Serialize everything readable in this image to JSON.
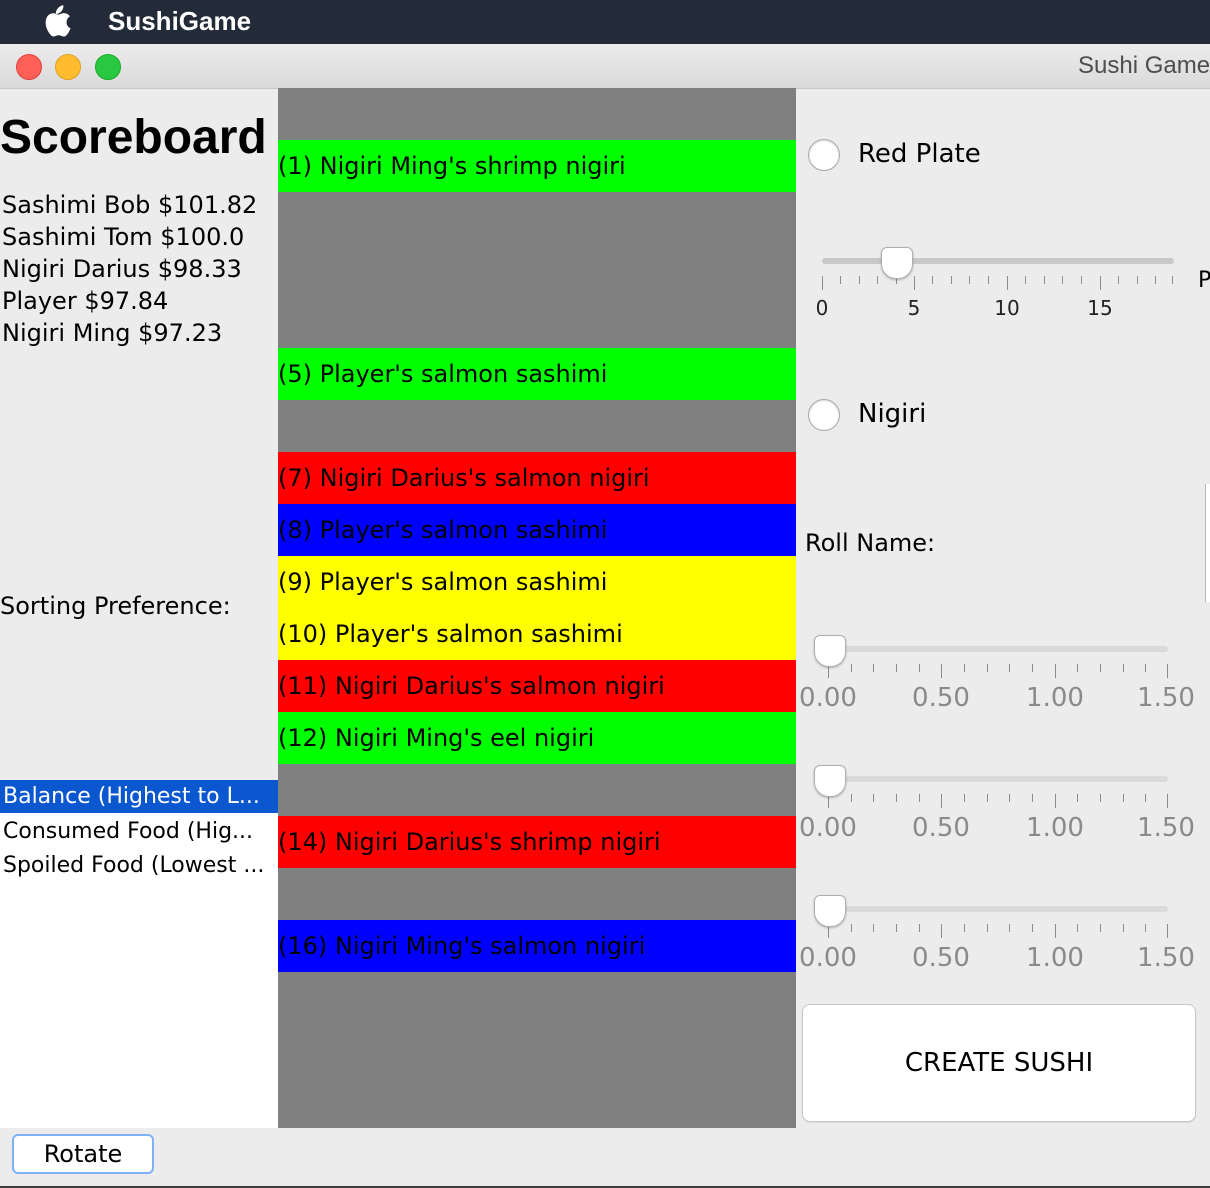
{
  "menubar": {
    "app_name": "SushiGame",
    "apple_icon": "apple-logo-icon"
  },
  "window": {
    "title": "Sushi Game"
  },
  "scoreboard": {
    "title": "Scoreboard",
    "entries": [
      "Sashimi Bob $101.82",
      "Sashimi Tom $100.0",
      "Nigiri Darius $98.33",
      "Player $97.84",
      "Nigiri Ming $97.23"
    ]
  },
  "sorting": {
    "label": "Sorting Preference:",
    "options": [
      {
        "label": "Balance (Highest to L...",
        "selected": true
      },
      {
        "label": "Consumed Food (Hig...",
        "selected": false
      },
      {
        "label": "Spoiled Food (Lowest ...",
        "selected": false
      }
    ],
    "selected_color": "#0b57d0"
  },
  "belt": {
    "background": "#808080",
    "plates": [
      {
        "slot": 1,
        "label": "(1)  Nigiri Ming's shrimp nigiri",
        "color": "#00ff00"
      },
      {
        "slot": 5,
        "label": "(5)  Player's salmon sashimi",
        "color": "#00ff00"
      },
      {
        "slot": 7,
        "label": "(7)  Nigiri Darius's salmon nigiri",
        "color": "#ff0000"
      },
      {
        "slot": 8,
        "label": "(8)  Player's salmon sashimi",
        "color": "#0000ff"
      },
      {
        "slot": 9,
        "label": "(9)  Player's salmon sashimi",
        "color": "#ffff00"
      },
      {
        "slot": 10,
        "label": "(10)  Player's salmon sashimi",
        "color": "#ffff00"
      },
      {
        "slot": 11,
        "label": "(11)  Nigiri Darius's salmon nigiri",
        "color": "#ff0000"
      },
      {
        "slot": 12,
        "label": "(12)  Nigiri Ming's eel nigiri",
        "color": "#00ff00"
      },
      {
        "slot": 14,
        "label": "(14)  Nigiri Darius's shrimp nigiri",
        "color": "#ff0000"
      },
      {
        "slot": 16,
        "label": "(16)  Nigiri Ming's salmon nigiri",
        "color": "#0000ff"
      }
    ]
  },
  "controls": {
    "radio_red_plate": "Red Plate",
    "radio_nigiri": "Nigiri",
    "position_slider": {
      "value": 4,
      "labels": [
        "0",
        "5",
        "10",
        "15"
      ]
    },
    "cut_label": "P",
    "roll_name_label": "Roll Name:",
    "amount_sliders": [
      {
        "value": 0,
        "labels": [
          "0.00",
          "0.50",
          "1.00",
          "1.50"
        ]
      },
      {
        "value": 0,
        "labels": [
          "0.00",
          "0.50",
          "1.00",
          "1.50"
        ]
      },
      {
        "value": 0,
        "labels": [
          "0.00",
          "0.50",
          "1.00",
          "1.50"
        ]
      }
    ],
    "create_button": "CREATE SUSHI",
    "rotate_button": "Rotate"
  }
}
